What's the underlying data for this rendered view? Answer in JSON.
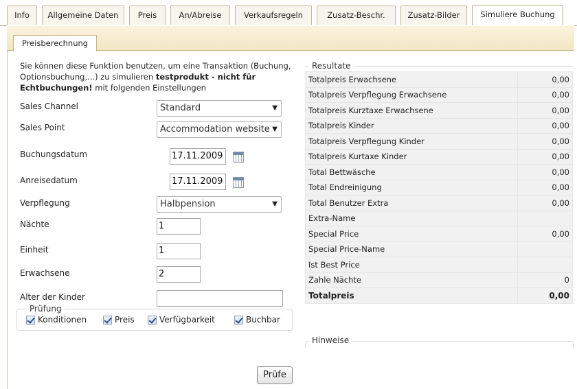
{
  "tabs": [
    {
      "label": "Info"
    },
    {
      "label": "Allgemeine Daten"
    },
    {
      "label": "Preis"
    },
    {
      "label": "An/Abreise"
    },
    {
      "label": "Verkaufsregeln"
    },
    {
      "label": "Zusatz-Beschr."
    },
    {
      "label": "Zusatz-Bilder"
    },
    {
      "label": "Simuliere Buchung"
    }
  ],
  "subtab": {
    "label": "Preisberechnung"
  },
  "intro": {
    "part1": "Sie können diese Funktion benutzen, um eine Transaktion (Buchung, Optionsbuchung,...) zu simulieren ",
    "bold": "testprodukt - nicht für Echtbuchungen!",
    "part2": " mit folgenden Einstellungen"
  },
  "form": {
    "sales_channel": {
      "label": "Sales Channel",
      "value": "Standard"
    },
    "sales_point": {
      "label": "Sales Point",
      "value": "Accommodation website"
    },
    "buchungsdatum": {
      "label": "Buchungsdatum",
      "value": "17.11.2009"
    },
    "anreisedatum": {
      "label": "Anreisedatum",
      "value": "17.11.2009"
    },
    "verpflegung": {
      "label": "Verpflegung",
      "value": "Halbpension"
    },
    "naechte": {
      "label": "Nächte",
      "value": "1"
    },
    "einheit": {
      "label": "Einheit",
      "value": "1"
    },
    "erwachsene": {
      "label": "Erwachsene",
      "value": "2"
    },
    "alter_kinder": {
      "label": "Alter der Kinder",
      "value": ""
    }
  },
  "pruefung": {
    "legend": "Prüfung",
    "checks": [
      {
        "label": "Konditionen",
        "checked": true
      },
      {
        "label": "Preis",
        "checked": true
      },
      {
        "label": "Verfügbarkeit",
        "checked": true
      },
      {
        "label": "Buchbar",
        "checked": true
      }
    ]
  },
  "button": {
    "label": "Prüfe"
  },
  "resultate": {
    "legend": "Resultate",
    "rows": [
      {
        "label": "Totalpreis Erwachsene",
        "value": "0,00"
      },
      {
        "label": "Totalpreis Verpflegung Erwachsene",
        "value": "0,00"
      },
      {
        "label": "Totalpreis Kurztaxe Erwachsene",
        "value": "0,00"
      },
      {
        "label": "Totalpreis Kinder",
        "value": "0,00"
      },
      {
        "label": "Totalpreis Verpflegung Kinder",
        "value": "0,00"
      },
      {
        "label": "Totalpreis Kurtaxe Kinder",
        "value": "0,00"
      },
      {
        "label": "Total Bettwäsche",
        "value": "0,00"
      },
      {
        "label": "Total Endreinigung",
        "value": "0,00"
      },
      {
        "label": "Total Benutzer Extra",
        "value": "0,00"
      },
      {
        "label": "Extra-Name",
        "value": ""
      },
      {
        "label": "Special Price",
        "value": "0,00"
      },
      {
        "label": "Special Price-Name",
        "value": ""
      },
      {
        "label": "Ist Best Price",
        "value": ""
      },
      {
        "label": "Zahle Nächte",
        "value": "0"
      },
      {
        "label": "Totalpreis",
        "value": "0,00"
      }
    ]
  },
  "hinweise": {
    "legend": "Hinweise"
  }
}
